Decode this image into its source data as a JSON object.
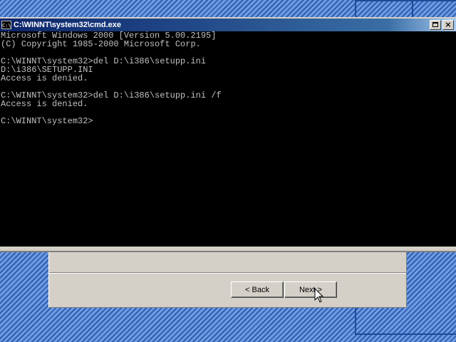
{
  "window": {
    "title": "C:\\WINNT\\system32\\cmd.exe",
    "icon": "cmd-icon",
    "icon_text": "C:\\",
    "restore_icon": "restore-icon",
    "close_glyph": "×"
  },
  "console": {
    "lines": [
      "Microsoft Windows 2000 [Version 5.00.2195]",
      "(C) Copyright 1985-2000 Microsoft Corp.",
      "",
      "C:\\WINNT\\system32>del D:\\i386\\setupp.ini",
      "D:\\i386\\SETUPP.INI",
      "Access is denied.",
      "",
      "C:\\WINNT\\system32>del D:\\i386\\setupp.ini /f",
      "Access is denied.",
      "",
      "C:\\WINNT\\system32>"
    ]
  },
  "wizard": {
    "back_label": "< Back",
    "next_label": "Next >"
  },
  "colors": {
    "titlebar": "#0a246a",
    "console_bg": "#000000",
    "console_fg": "#c0c0c0",
    "desktop": "#4a7fd0"
  }
}
